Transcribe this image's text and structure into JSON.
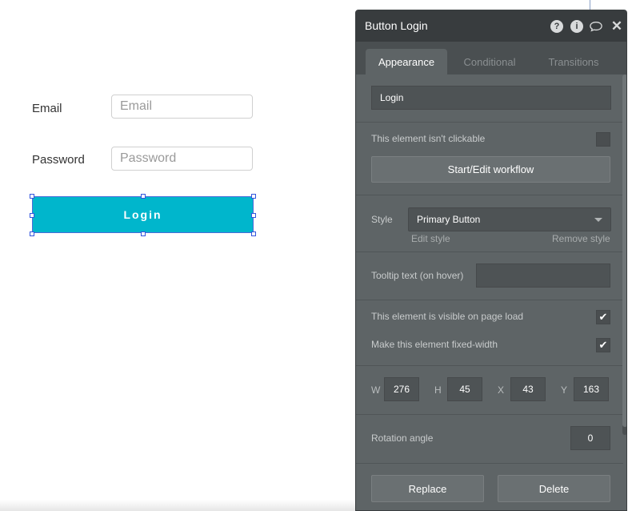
{
  "canvas": {
    "email_label": "Email",
    "email_placeholder": "Email",
    "password_label": "Password",
    "password_placeholder": "Password",
    "login_button_label": "Login"
  },
  "panel": {
    "title": "Button Login",
    "header_icons": [
      "help-icon",
      "info-icon",
      "comment-icon",
      "close-icon"
    ],
    "tabs": [
      {
        "label": "Appearance",
        "active": true
      },
      {
        "label": "Conditional",
        "active": false
      },
      {
        "label": "Transitions",
        "active": false
      }
    ],
    "text_value": "Login",
    "not_clickable_label": "This element isn't clickable",
    "not_clickable_checked": false,
    "workflow_button": "Start/Edit workflow",
    "style_label": "Style",
    "style_value": "Primary Button",
    "edit_style": "Edit style",
    "remove_style": "Remove style",
    "tooltip_label": "Tooltip text (on hover)",
    "tooltip_value": "",
    "visible_label": "This element is visible on page load",
    "visible_checked": true,
    "fixed_width_label": "Make this element fixed-width",
    "fixed_width_checked": true,
    "dimensions": {
      "w_label": "W",
      "w": "276",
      "h_label": "H",
      "h": "45",
      "x_label": "X",
      "x": "43",
      "y_label": "Y",
      "y": "163"
    },
    "rotation_label": "Rotation angle",
    "rotation_value": "0",
    "replace_button": "Replace",
    "delete_button": "Delete",
    "check_glyph": "✔"
  },
  "colors": {
    "login_button": "#00b6cc",
    "panel_bg": "#5e6466",
    "panel_header": "#383c3e",
    "selection": "#3355dd"
  }
}
